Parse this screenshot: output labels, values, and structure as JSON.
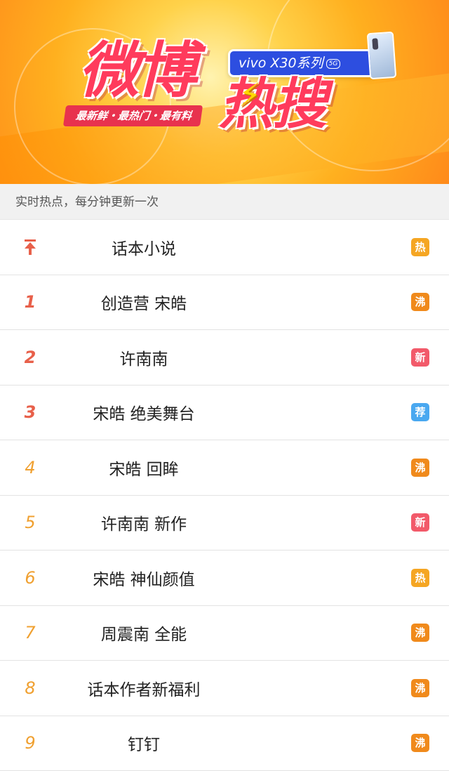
{
  "banner": {
    "logo_top": "微博",
    "logo_bottom": "热搜",
    "tagline": "最新鲜・最热门・最有料",
    "sponsor": "vivo X30系列",
    "sponsor_5g": "5G"
  },
  "subheader": "实时热点，每分钟更新一次",
  "colors": {
    "hot": "#f5a623",
    "boil": "#f08a1c",
    "new": "#f25a6a",
    "recommend": "#4aa8f0",
    "rank_top": "#e8604a",
    "rank_other": "#f0a030"
  },
  "items": [
    {
      "rank": "",
      "pinned": true,
      "title": "话本小说",
      "badge": "热",
      "badge_type": "hot"
    },
    {
      "rank": "1",
      "title": "创造营 宋皓",
      "badge": "沸",
      "badge_type": "boil"
    },
    {
      "rank": "2",
      "title": "许南南",
      "badge": "新",
      "badge_type": "new"
    },
    {
      "rank": "3",
      "title": "宋皓 绝美舞台",
      "badge": "荐",
      "badge_type": "recommend"
    },
    {
      "rank": "4",
      "title": "宋皓 回眸",
      "badge": "沸",
      "badge_type": "boil"
    },
    {
      "rank": "5",
      "title": "许南南 新作",
      "badge": "新",
      "badge_type": "new"
    },
    {
      "rank": "6",
      "title": "宋皓 神仙颜值",
      "badge": "热",
      "badge_type": "hot"
    },
    {
      "rank": "7",
      "title": "周震南 全能",
      "badge": "沸",
      "badge_type": "boil"
    },
    {
      "rank": "8",
      "title": "话本作者新福利",
      "badge": "沸",
      "badge_type": "boil"
    },
    {
      "rank": "9",
      "title": "钉钉",
      "badge": "沸",
      "badge_type": "boil"
    }
  ]
}
